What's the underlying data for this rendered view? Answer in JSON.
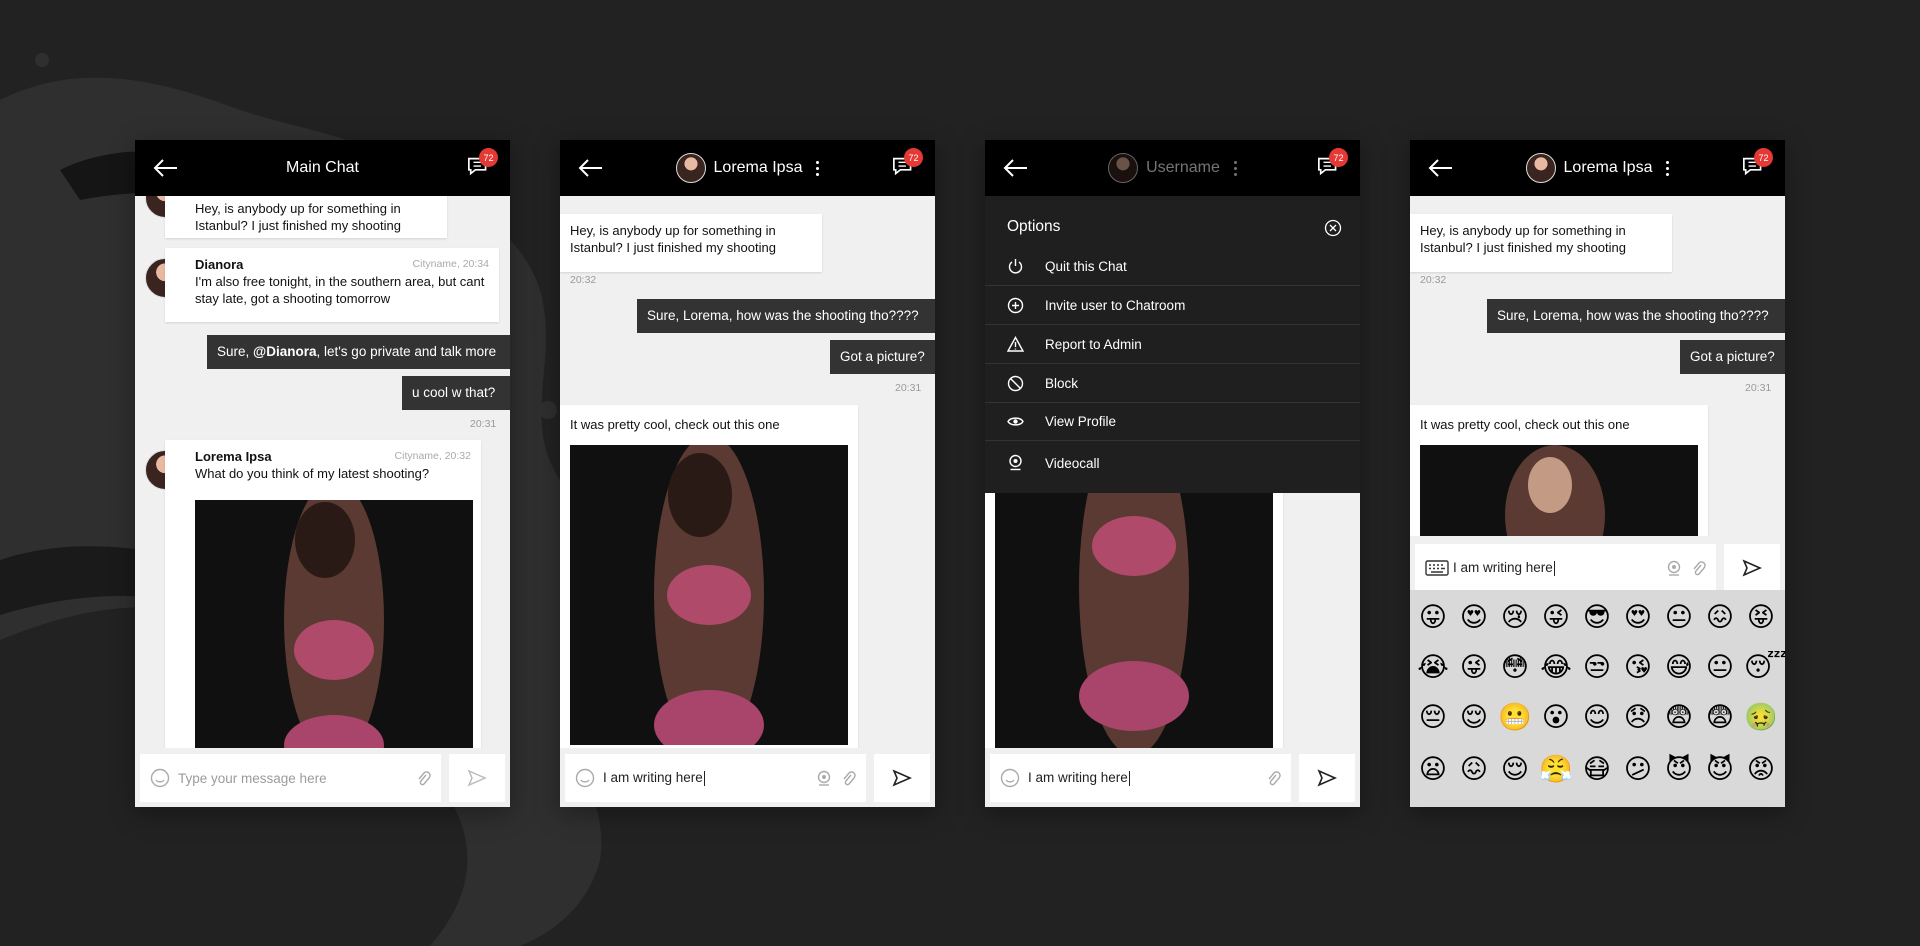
{
  "screens": [
    {
      "header": {
        "title": "Main Chat",
        "badge": "72"
      },
      "messages": {
        "m1_text": "Hey, is anybody up for something in Istanbul? I just finished my shooting",
        "m2_sender": "Dianora",
        "m2_meta": "Cityname, 20:34",
        "m2_text": "I'm also free tonight, in the southern area, but cant stay late, got a shooting tomorrow",
        "m3_prefix": "Sure, ",
        "m3_mention": "@Dianora",
        "m3_suffix": ", let's go private and talk more",
        "m4_text": "u cool w that?",
        "m4_time": "20:31",
        "m5_sender": "Lorema Ipsa",
        "m5_meta": "Cityname, 20:32",
        "m5_text": "What do you think of my latest shooting?"
      },
      "input": {
        "placeholder": "Type your message here"
      }
    },
    {
      "header": {
        "name": "Lorema Ipsa",
        "badge": "72"
      },
      "messages": {
        "m1_text": "Hey, is anybody up for something in Istanbul? I just finished my shooting",
        "m1_time": "20:32",
        "m2_text": "Sure, Lorema, how was the shooting tho????",
        "m3_text": "Got a picture?",
        "m3_time": "20:31",
        "m4_text": "It was pretty cool, check out this one"
      },
      "input": {
        "value": "I am writing here"
      }
    },
    {
      "header": {
        "name": "Username",
        "badge": "72"
      },
      "options": {
        "title": "Options",
        "items": [
          "Quit this Chat",
          "Invite user to Chatroom",
          "Report to Admin",
          "Block",
          "View Profile",
          "Videocall"
        ]
      },
      "input": {
        "value": "I am writing here"
      }
    },
    {
      "header": {
        "name": "Lorema Ipsa",
        "badge": "72"
      },
      "messages": {
        "m1_text": "Hey, is anybody up for something in Istanbul? I just finished my shooting",
        "m1_time": "20:32",
        "m2_text": "Sure, Lorema, how was the shooting tho????",
        "m3_text": "Got a picture?",
        "m3_time": "20:31",
        "m4_text": "It was pretty cool, check out this one"
      },
      "input": {
        "value": "I am writing here"
      },
      "emojis": [
        "😛",
        "😍",
        "😢",
        "😜",
        "😎",
        "😍",
        "😐",
        "😖",
        "😝",
        "😭",
        "😜",
        "😳",
        "😂",
        "😒",
        "😘",
        "😅",
        "😐",
        "😴",
        "😔",
        "😌",
        "😬",
        "😮",
        "😊",
        "😞",
        "😨",
        "😨",
        "🤢",
        "😦",
        "😖",
        "😌",
        "😤",
        "😷",
        "😕",
        "😈",
        "😈",
        "😡"
      ]
    }
  ],
  "colors": {
    "background": "#222223",
    "topbar": "#000000",
    "badge": "#e53935",
    "outgoing": "#333333",
    "chat_bg": "#f0f0f0"
  }
}
